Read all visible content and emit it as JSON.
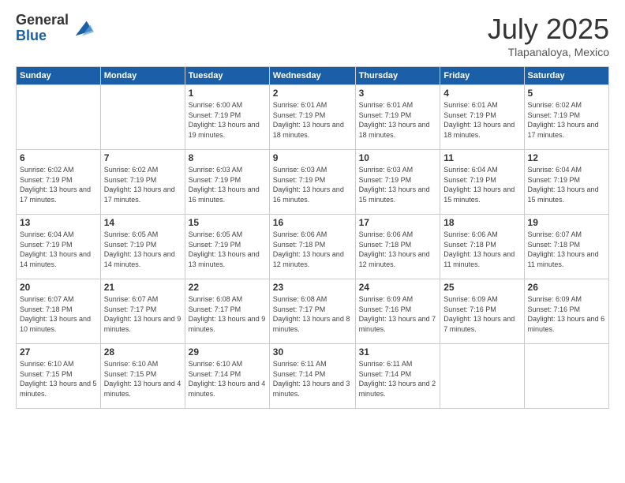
{
  "logo": {
    "general": "General",
    "blue": "Blue"
  },
  "header": {
    "month": "July 2025",
    "location": "Tlapanaloya, Mexico"
  },
  "days_of_week": [
    "Sunday",
    "Monday",
    "Tuesday",
    "Wednesday",
    "Thursday",
    "Friday",
    "Saturday"
  ],
  "weeks": [
    [
      {
        "day": "",
        "info": ""
      },
      {
        "day": "",
        "info": ""
      },
      {
        "day": "1",
        "info": "Sunrise: 6:00 AM\nSunset: 7:19 PM\nDaylight: 13 hours and 19 minutes."
      },
      {
        "day": "2",
        "info": "Sunrise: 6:01 AM\nSunset: 7:19 PM\nDaylight: 13 hours and 18 minutes."
      },
      {
        "day": "3",
        "info": "Sunrise: 6:01 AM\nSunset: 7:19 PM\nDaylight: 13 hours and 18 minutes."
      },
      {
        "day": "4",
        "info": "Sunrise: 6:01 AM\nSunset: 7:19 PM\nDaylight: 13 hours and 18 minutes."
      },
      {
        "day": "5",
        "info": "Sunrise: 6:02 AM\nSunset: 7:19 PM\nDaylight: 13 hours and 17 minutes."
      }
    ],
    [
      {
        "day": "6",
        "info": "Sunrise: 6:02 AM\nSunset: 7:19 PM\nDaylight: 13 hours and 17 minutes."
      },
      {
        "day": "7",
        "info": "Sunrise: 6:02 AM\nSunset: 7:19 PM\nDaylight: 13 hours and 17 minutes."
      },
      {
        "day": "8",
        "info": "Sunrise: 6:03 AM\nSunset: 7:19 PM\nDaylight: 13 hours and 16 minutes."
      },
      {
        "day": "9",
        "info": "Sunrise: 6:03 AM\nSunset: 7:19 PM\nDaylight: 13 hours and 16 minutes."
      },
      {
        "day": "10",
        "info": "Sunrise: 6:03 AM\nSunset: 7:19 PM\nDaylight: 13 hours and 15 minutes."
      },
      {
        "day": "11",
        "info": "Sunrise: 6:04 AM\nSunset: 7:19 PM\nDaylight: 13 hours and 15 minutes."
      },
      {
        "day": "12",
        "info": "Sunrise: 6:04 AM\nSunset: 7:19 PM\nDaylight: 13 hours and 15 minutes."
      }
    ],
    [
      {
        "day": "13",
        "info": "Sunrise: 6:04 AM\nSunset: 7:19 PM\nDaylight: 13 hours and 14 minutes."
      },
      {
        "day": "14",
        "info": "Sunrise: 6:05 AM\nSunset: 7:19 PM\nDaylight: 13 hours and 14 minutes."
      },
      {
        "day": "15",
        "info": "Sunrise: 6:05 AM\nSunset: 7:19 PM\nDaylight: 13 hours and 13 minutes."
      },
      {
        "day": "16",
        "info": "Sunrise: 6:06 AM\nSunset: 7:18 PM\nDaylight: 13 hours and 12 minutes."
      },
      {
        "day": "17",
        "info": "Sunrise: 6:06 AM\nSunset: 7:18 PM\nDaylight: 13 hours and 12 minutes."
      },
      {
        "day": "18",
        "info": "Sunrise: 6:06 AM\nSunset: 7:18 PM\nDaylight: 13 hours and 11 minutes."
      },
      {
        "day": "19",
        "info": "Sunrise: 6:07 AM\nSunset: 7:18 PM\nDaylight: 13 hours and 11 minutes."
      }
    ],
    [
      {
        "day": "20",
        "info": "Sunrise: 6:07 AM\nSunset: 7:18 PM\nDaylight: 13 hours and 10 minutes."
      },
      {
        "day": "21",
        "info": "Sunrise: 6:07 AM\nSunset: 7:17 PM\nDaylight: 13 hours and 9 minutes."
      },
      {
        "day": "22",
        "info": "Sunrise: 6:08 AM\nSunset: 7:17 PM\nDaylight: 13 hours and 9 minutes."
      },
      {
        "day": "23",
        "info": "Sunrise: 6:08 AM\nSunset: 7:17 PM\nDaylight: 13 hours and 8 minutes."
      },
      {
        "day": "24",
        "info": "Sunrise: 6:09 AM\nSunset: 7:16 PM\nDaylight: 13 hours and 7 minutes."
      },
      {
        "day": "25",
        "info": "Sunrise: 6:09 AM\nSunset: 7:16 PM\nDaylight: 13 hours and 7 minutes."
      },
      {
        "day": "26",
        "info": "Sunrise: 6:09 AM\nSunset: 7:16 PM\nDaylight: 13 hours and 6 minutes."
      }
    ],
    [
      {
        "day": "27",
        "info": "Sunrise: 6:10 AM\nSunset: 7:15 PM\nDaylight: 13 hours and 5 minutes."
      },
      {
        "day": "28",
        "info": "Sunrise: 6:10 AM\nSunset: 7:15 PM\nDaylight: 13 hours and 4 minutes."
      },
      {
        "day": "29",
        "info": "Sunrise: 6:10 AM\nSunset: 7:14 PM\nDaylight: 13 hours and 4 minutes."
      },
      {
        "day": "30",
        "info": "Sunrise: 6:11 AM\nSunset: 7:14 PM\nDaylight: 13 hours and 3 minutes."
      },
      {
        "day": "31",
        "info": "Sunrise: 6:11 AM\nSunset: 7:14 PM\nDaylight: 13 hours and 2 minutes."
      },
      {
        "day": "",
        "info": ""
      },
      {
        "day": "",
        "info": ""
      }
    ]
  ]
}
